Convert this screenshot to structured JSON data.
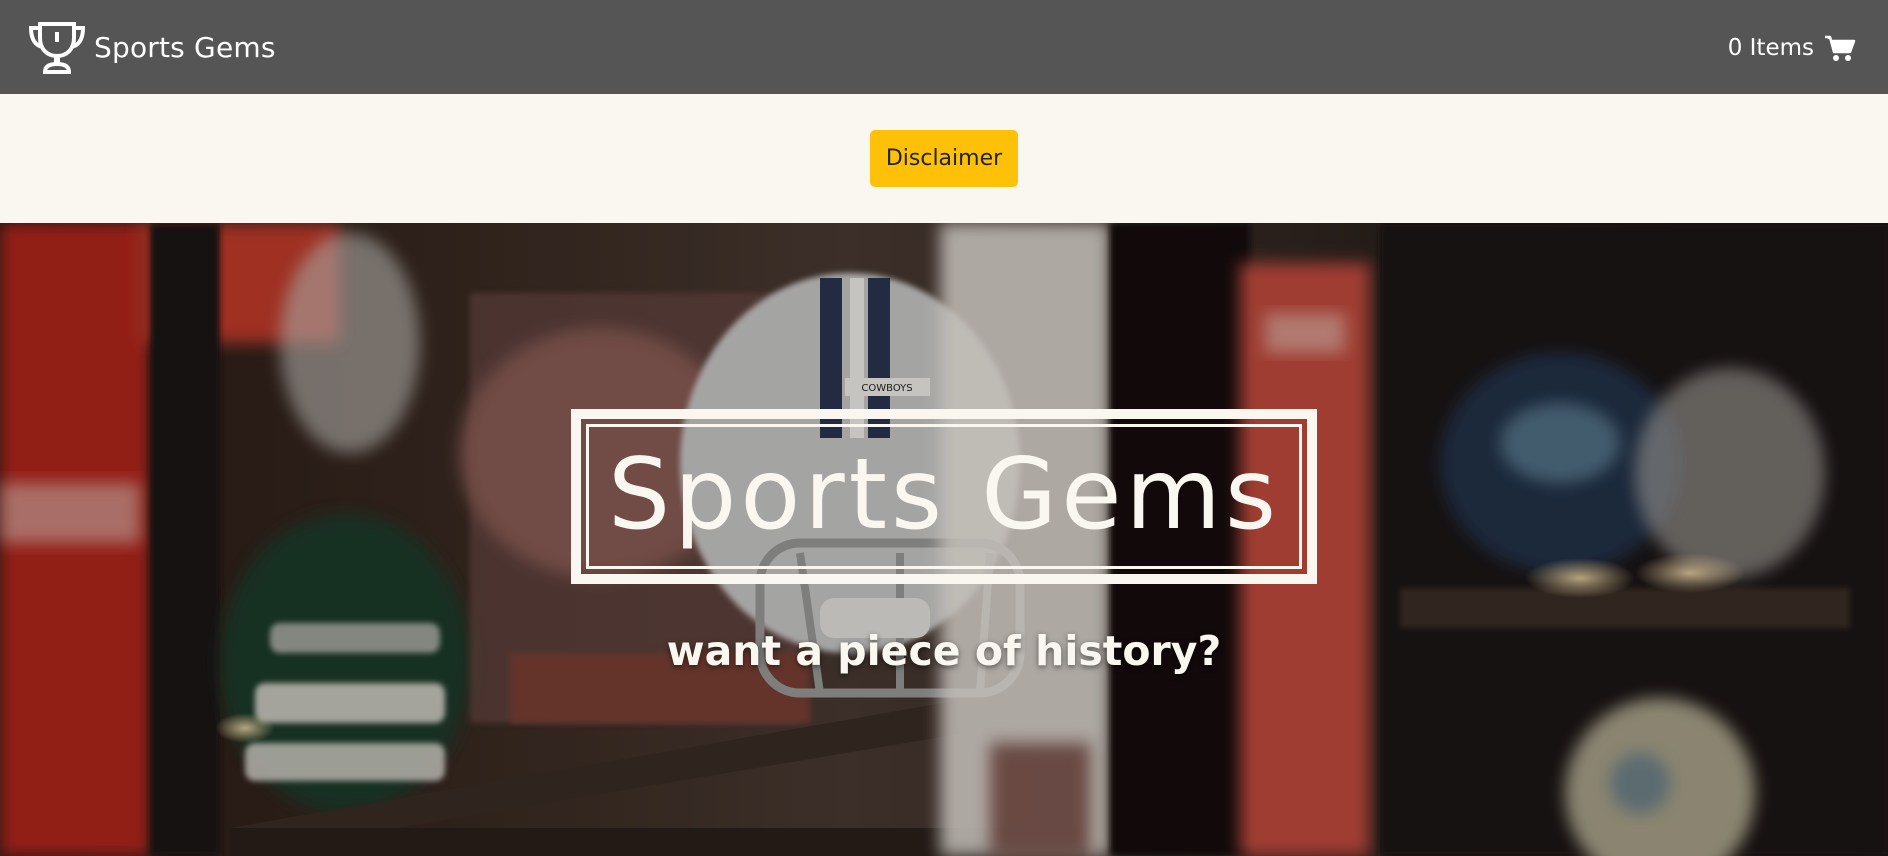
{
  "navbar": {
    "brand_icon": "trophy-icon",
    "brand_text": "Sports Gems",
    "cart_text": "0 Items",
    "cart_icon": "shopping-cart-icon",
    "background": "#555555"
  },
  "disclaimer": {
    "button_label": "Disclaimer",
    "button_color": "#ffc107"
  },
  "hero": {
    "title": "Sports Gems",
    "subtitle": "want a piece of history?",
    "background_description_icon": "memorabilia-shelf-photo"
  }
}
